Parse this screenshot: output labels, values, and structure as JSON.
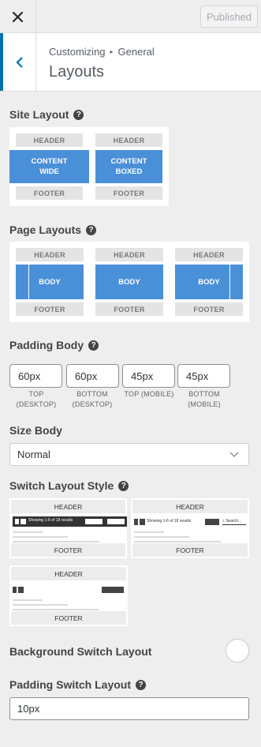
{
  "topbar": {
    "close_icon": "close-icon",
    "publish_label": "Published"
  },
  "section": {
    "breadcrumb_root": "Customizing",
    "breadcrumb_child": "General",
    "title": "Layouts"
  },
  "site_layout": {
    "label": "Site Layout",
    "options": [
      {
        "header": "HEADER",
        "body_line1": "CONTENT",
        "body_line2": "WIDE",
        "footer": "FOOTER"
      },
      {
        "header": "HEADER",
        "body_line1": "CONTENT",
        "body_line2": "BOXED",
        "footer": "FOOTER"
      }
    ]
  },
  "page_layouts": {
    "label": "Page Layouts",
    "options": [
      {
        "header": "HEADER",
        "body": "BODY",
        "footer": "FOOTER",
        "variant": "left-sidebar"
      },
      {
        "header": "HEADER",
        "body": "BODY",
        "footer": "FOOTER",
        "variant": "full"
      },
      {
        "header": "HEADER",
        "body": "BODY",
        "footer": "FOOTER",
        "variant": "right-sidebar"
      }
    ]
  },
  "padding_body": {
    "label": "Padding Body",
    "fields": [
      {
        "value": "60px",
        "caption_1": "TOP",
        "caption_2": "(DESKTOP)"
      },
      {
        "value": "60px",
        "caption_1": "BOTTOM",
        "caption_2": "(DESKTOP)"
      },
      {
        "value": "45px",
        "caption_1": "TOP (MOBILE)",
        "caption_2": ""
      },
      {
        "value": "45px",
        "caption_1": "BOTTOM",
        "caption_2": "(MOBILE)"
      }
    ]
  },
  "size_body": {
    "label": "Size Body",
    "selected": "Normal"
  },
  "switch_layout_style": {
    "label": "Switch Layout Style",
    "options": [
      {
        "header": "HEADER",
        "footer": "FOOTER",
        "toolbar_text": "Showing 1-6 of 18 results"
      },
      {
        "header": "HEADER",
        "footer": "FOOTER",
        "toolbar_text": "Showing 1-6 of 18 results",
        "search_text": "Search..."
      },
      {
        "header": "HEADER",
        "footer": "FOOTER"
      }
    ]
  },
  "background_switch_layout": {
    "label": "Background Switch Layout"
  },
  "padding_switch_layout": {
    "label": "Padding Switch Layout",
    "value": "10px"
  },
  "colors": {
    "accent": "#0073aa",
    "layout_blue": "#4a90d9",
    "panel_bg": "#eeeeee"
  }
}
